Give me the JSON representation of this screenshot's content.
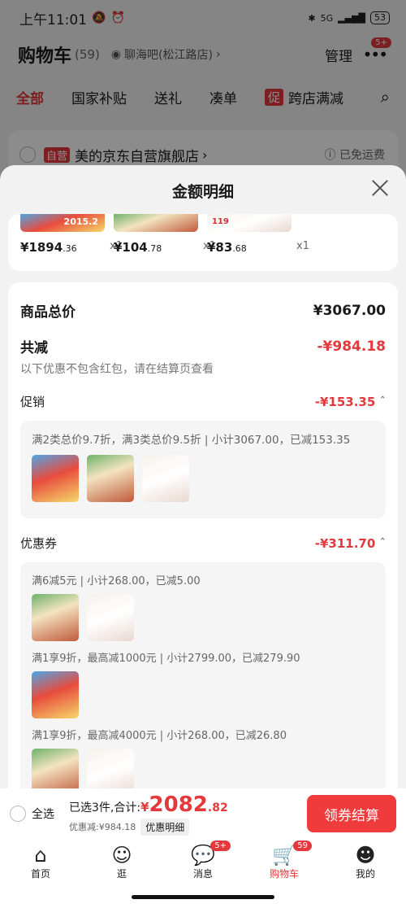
{
  "status": {
    "time": "上午11:01",
    "battery": "53",
    "network": "5G"
  },
  "header": {
    "title": "购物车",
    "count": "(59)",
    "location": "聊海吧(松江路店)",
    "manage": "管理",
    "more_badge": "5+"
  },
  "tabs": [
    "全部",
    "国家补贴",
    "送礼",
    "凑单",
    "跨店满减"
  ],
  "tabs_promo_tag": "促",
  "shop": {
    "tag": "自营",
    "name": "美的京东自营旗舰店",
    "shipping": "已免运费"
  },
  "sheet": {
    "title": "金额明细",
    "products": [
      {
        "price_main": "¥1894",
        "price_dec": ".36",
        "qty": "x1",
        "img_text": "2015.2"
      },
      {
        "price_main": "¥104",
        "price_dec": ".78",
        "qty": "x1"
      },
      {
        "price_main": "¥83",
        "price_dec": ".68",
        "qty": "x1",
        "img_text": "119"
      }
    ],
    "total_label": "商品总价",
    "total_value": "¥3067.00",
    "reduce_label": "共减",
    "reduce_value": "-¥984.18",
    "reduce_note": "以下优惠不包含红包，请在结算页查看",
    "promo_label": "促销",
    "promo_value": "-¥153.35",
    "promo_desc": "满2类总价9.7折，满3类总价9.5折 | 小计3067.00，已减153.35",
    "coupon_label": "优惠券",
    "coupon_value": "-¥311.70",
    "coupons": [
      "满6减5元 | 小计268.00，已减5.00",
      "满1享9折，最高减1000元 | 小计2799.00，已减279.90",
      "满1享9折，最高减4000元 | 小计268.00，已减26.80"
    ]
  },
  "bottom": {
    "select_all": "全选",
    "selected": "已选3件,合计:",
    "currency": "¥",
    "amount_main": "2082",
    "amount_dec": ".82",
    "discount": "优惠减:¥984.18",
    "detail_btn": "优惠明细",
    "pay_btn": "领券结算"
  },
  "nav": [
    {
      "label": "首页"
    },
    {
      "label": "逛"
    },
    {
      "label": "消息",
      "badge": "5+"
    },
    {
      "label": "购物车",
      "badge": "59"
    },
    {
      "label": "我的"
    }
  ],
  "colors": {
    "accent": "#e4393c",
    "button": "#ef3b3b"
  }
}
